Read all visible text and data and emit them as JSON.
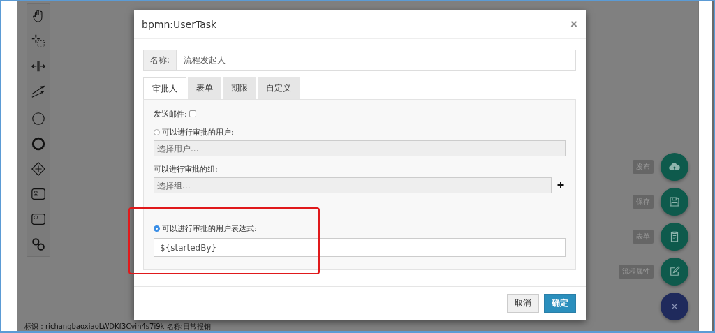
{
  "palette": {
    "tools": [
      {
        "kind": "hand"
      },
      {
        "kind": "lasso"
      },
      {
        "kind": "space"
      },
      {
        "kind": "connect"
      },
      {
        "kind": "start-event"
      },
      {
        "kind": "end-event"
      },
      {
        "kind": "gateway"
      },
      {
        "kind": "user-task"
      },
      {
        "kind": "service-task"
      },
      {
        "kind": "link"
      }
    ]
  },
  "footer": {
    "text": "标识：richangbaoxiaoLWDKf3Cvin4s7i9k   名称:日常报销"
  },
  "actions": [
    {
      "kind": "publish",
      "label": "发布"
    },
    {
      "kind": "save",
      "label": "保存"
    },
    {
      "kind": "form",
      "label": "表单"
    },
    {
      "kind": "properties",
      "label": "流程属性"
    },
    {
      "kind": "close"
    }
  ],
  "dialog": {
    "title": "bpmn:UserTask",
    "close": "×",
    "name_field": {
      "label": "名称:",
      "value": "流程发起人"
    },
    "tabs": [
      {
        "label": "审批人",
        "selected": true
      },
      {
        "label": "表单",
        "selected": false
      },
      {
        "label": "期限",
        "selected": false
      },
      {
        "label": "自定义",
        "selected": false
      }
    ],
    "send_email": {
      "label": "发送邮件:",
      "checked": false
    },
    "users": {
      "label": "可以进行审批的用户:",
      "selected": false,
      "placeholder": "选择用户..."
    },
    "groups": {
      "label": "可以进行审批的组:",
      "placeholder": "选择组...",
      "add": "+"
    },
    "expression": {
      "label": "可以进行审批的用户表达式:",
      "selected": true,
      "value": "${startedBy}"
    },
    "buttons": [
      {
        "kind": "default",
        "label": "取消"
      },
      {
        "kind": "primary",
        "label": "确定"
      }
    ]
  }
}
